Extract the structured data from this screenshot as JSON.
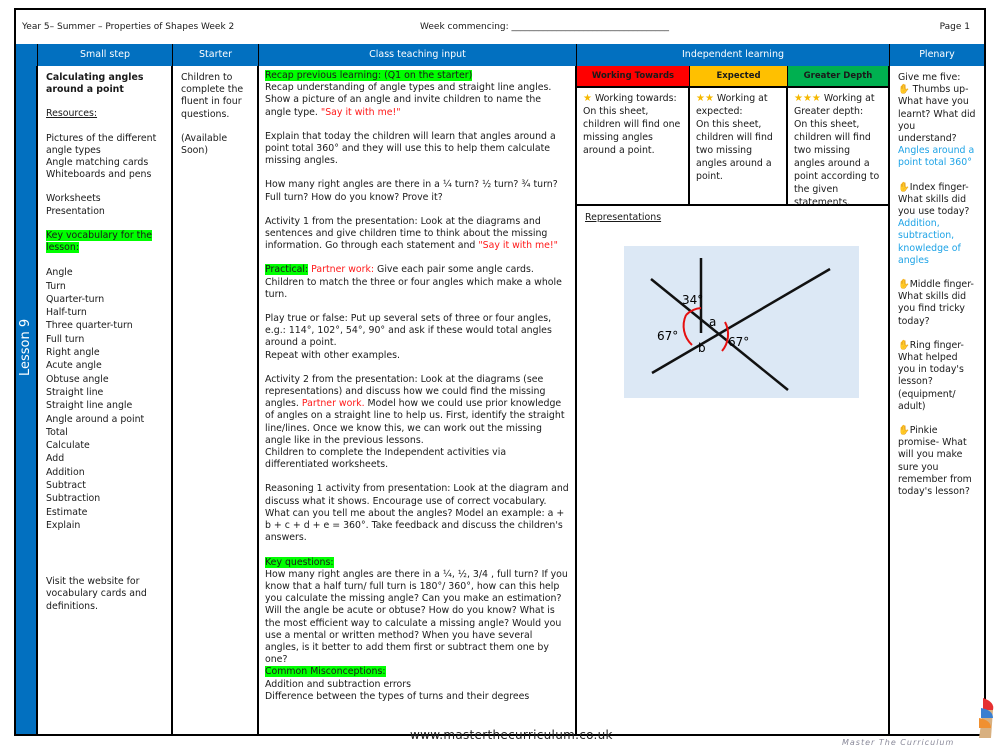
{
  "topbar": {
    "title": "Year 5– Summer – Properties of Shapes Week 2",
    "week_commencing": "Week commencing: ___________________________________",
    "page": "Page 1"
  },
  "headers": {
    "small_step": "Small step",
    "starter": "Starter",
    "class_teaching": "Class teaching input",
    "independent": "Independent learning",
    "plenary": "Plenary"
  },
  "lesson_label": "Lesson 9",
  "small_step": {
    "title": "Calculating angles around a point",
    "resources_label": "Resources:",
    "resources": [
      "Pictures of the different angle types",
      "Angle matching cards",
      "Whiteboards and pens"
    ],
    "resources2": [
      "Worksheets",
      "Presentation"
    ],
    "vocab_label": "Key vocabulary for the lesson:",
    "vocab": [
      "Angle",
      "Turn",
      "Quarter-turn",
      "Half-turn",
      "Three quarter-turn",
      "Full turn",
      "Right angle",
      "Acute angle",
      "Obtuse angle",
      "Straight line",
      "Straight line angle",
      "Angle around a point",
      "Total",
      "Calculate",
      "Add",
      "Addition",
      "Subtract",
      "Subtraction",
      "Estimate",
      "Explain"
    ],
    "website_note": "Visit the website for vocabulary cards and definitions."
  },
  "starter": {
    "text": "Children to complete the fluent in four questions.",
    "availability": "(Available Soon)"
  },
  "class_teaching": {
    "recap_label": "Recap previous learning: (Q1 on the starter)",
    "recap_text": "Recap understanding of angle types and straight line angles. Show a picture of an angle and invite children to name the angle type. ",
    "say_it": "\"Say it with me!\"",
    "explain": "Explain that today the children will learn that angles around a point total 360° and they will use this to help them calculate missing angles.",
    "right_angles_q": "How many right angles are there in a ¼ turn? ½ turn? ¾ turn? Full turn? How do you know? Prove it?",
    "activity1": "Activity 1 from the presentation: Look at the diagrams and sentences and give children time to think about the missing information. Go through each statement and ",
    "practical_label": "Practical:",
    "partner_work": " Partner work:",
    "practical_text": " Give each pair some angle cards. Children to match the three or four angles which make a whole turn.",
    "true_false": "Play true or false: Put up several sets of three or four angles, e.g.: 114°, 102°, 54°, 90° and ask if these would total angles around a point.",
    "repeat": "Repeat with other examples.",
    "activity2_a": "Activity 2 from the presentation: Look at the diagrams (see representations) and discuss how we could find the missing angles. ",
    "activity2_partner": "Partner work.",
    "activity2_b": " Model how we could use prior knowledge of angles on a straight line to help us. First, identify the straight line/lines. Once we know this, we can work out the missing angle like in the previous lessons.",
    "children_complete": "Children to complete the Independent activities  via differentiated worksheets.",
    "reasoning": "Reasoning 1 activity from presentation: Look at the diagram and discuss what it shows. Encourage use of correct vocabulary. What can you tell me about the angles? Model an example: a + b + c + d + e = 360°.  Take feedback and discuss the children's answers.",
    "key_questions_label": "Key questions:",
    "key_questions": "How many right angles are there in a ¼, ½, 3/4 , full turn? If you know that a half turn/ full turn is 180°/ 360°, how can this help you calculate the missing angle? Can you make an estimation? Will the angle be acute or obtuse? How do you know?  What is the most efficient way to calculate a missing angle? Would you use a mental or written method? When you have several angles, is it better to add them first or subtract them one by one?",
    "misconceptions_label": "Common Misconceptions:",
    "misconceptions": [
      "Addition and subtraction errors",
      "Difference between the types of turns and their degrees"
    ]
  },
  "independent": {
    "levels": [
      {
        "label": "Working Towards",
        "color": "#ff0000",
        "stars": "★",
        "heading": " Working towards:",
        "text": "On this sheet, children will find one missing angles around a point."
      },
      {
        "label": "Expected",
        "color": "#ffc000",
        "stars": "★★",
        "heading": " Working at expected:",
        "text": "On this sheet, children will find two missing angles around a point."
      },
      {
        "label": "Greater Depth",
        "color": "#00b050",
        "stars": "★★★",
        "heading": " Working at Greater depth:",
        "text": "On this sheet, children will find two missing angles around a point according to the given statements."
      }
    ],
    "representations_label": "Representations",
    "diagram": {
      "labels": {
        "top": "34°",
        "left": "67°",
        "right": "67°",
        "a": "a",
        "b": "b"
      }
    }
  },
  "plenary": {
    "intro": "Give me five:",
    "items": [
      {
        "finger": " Thumbs up-",
        "question": "What have you learnt? What did you understand?",
        "answer": "Angles around a point total 360°"
      },
      {
        "finger": "Index finger-",
        "question": "What skills did you use today?",
        "answer": "Addition, subtraction, knowledge of angles"
      },
      {
        "finger": "Middle finger-",
        "question": "What skills did you find tricky today?",
        "answer": ""
      },
      {
        "finger": "Ring finger-",
        "question": "What helped you in today's lesson? (equipment/ adult)",
        "answer": ""
      },
      {
        "finger": "Pinkie promise-",
        "question": " What will you make sure you remember from today's lesson?",
        "answer": ""
      }
    ]
  },
  "footer": {
    "url": "www.masterthecurriculum.co.uk",
    "brand": "Master The Curriculum"
  }
}
